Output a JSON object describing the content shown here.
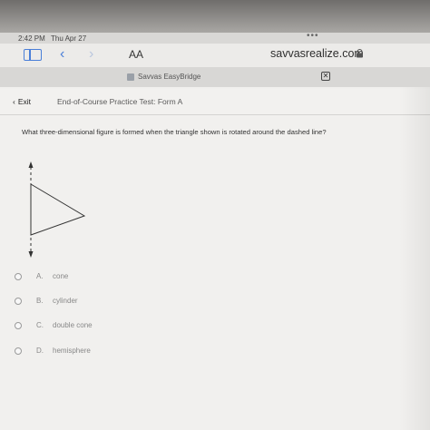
{
  "status": {
    "time": "2:42 PM",
    "date": "Thu Apr 27"
  },
  "browser": {
    "text_size_label": "AA",
    "url": "savvasrealize.com",
    "tab_label": "Savvas EasyBridge",
    "icons": {
      "sidebar": "sidebar-icon",
      "back": "chevron-left-icon",
      "forward": "chevron-right-icon",
      "lock": "lock-icon",
      "close": "close-icon"
    },
    "accent_color": "#4a7fd8"
  },
  "header": {
    "exit_label": "Exit",
    "test_title": "End-of-Course Practice Test: Form A"
  },
  "question": {
    "text": "What three-dimensional figure is formed when the triangle shown is rotated around the dashed line?"
  },
  "choices": [
    {
      "letter": "A.",
      "text": "cone"
    },
    {
      "letter": "B.",
      "text": "cylinder"
    },
    {
      "letter": "C.",
      "text": "double cone"
    },
    {
      "letter": "D.",
      "text": "hemisphere"
    }
  ]
}
